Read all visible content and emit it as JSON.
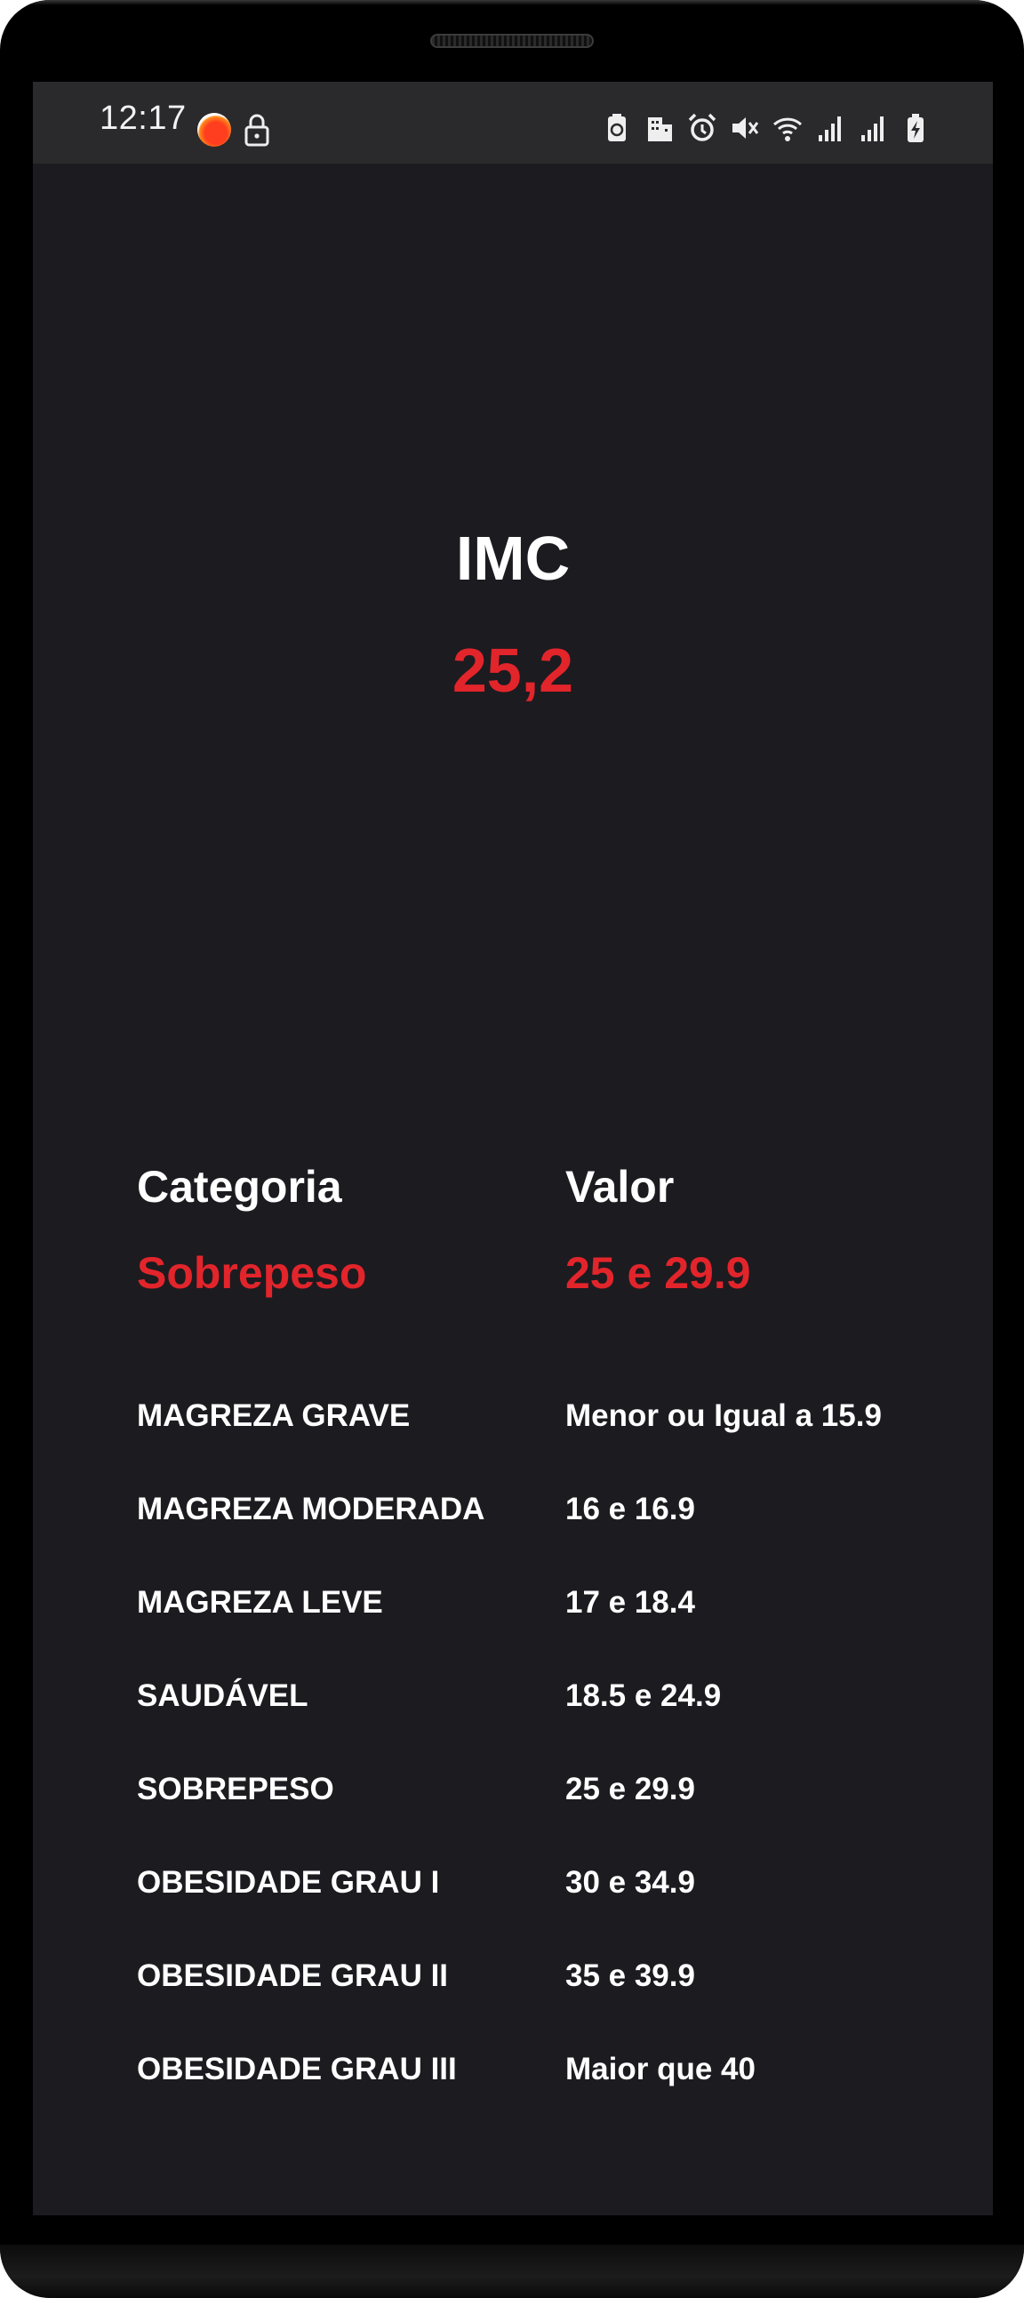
{
  "status_bar": {
    "time": "12:17",
    "left_icons": [
      "app-notification-icon",
      "lock-icon"
    ],
    "right_icons": [
      "battery-saver-icon",
      "building-icon",
      "alarm-icon",
      "mute-icon",
      "wifi-icon",
      "signal-icon",
      "signal-icon",
      "battery-charging-icon"
    ]
  },
  "result": {
    "title": "IMC",
    "value": "25,2"
  },
  "summary": {
    "header_category": "Categoria",
    "header_value": "Valor",
    "category": "Sobrepeso",
    "range": "25 e 29.9"
  },
  "table": {
    "rows": [
      {
        "category": "MAGREZA GRAVE",
        "range": "Menor ou Igual a 15.9"
      },
      {
        "category": "MAGREZA MODERADA",
        "range": "16 e 16.9"
      },
      {
        "category": "MAGREZA LEVE",
        "range": "17 e 18.4"
      },
      {
        "category": "SAUDÁVEL",
        "range": "18.5 e 24.9"
      },
      {
        "category": "SOBREPESO",
        "range": "25 e 29.9"
      },
      {
        "category": "OBESIDADE GRAU I",
        "range": "30 e 34.9"
      },
      {
        "category": "OBESIDADE GRAU II",
        "range": "35 e 39.9"
      },
      {
        "category": "OBESIDADE GRAU III",
        "range": "Maior que 40"
      }
    ]
  },
  "colors": {
    "background": "#1c1b20",
    "status_bar": "#2a2a2c",
    "accent": "#e2252b",
    "text": "#ffffff"
  }
}
